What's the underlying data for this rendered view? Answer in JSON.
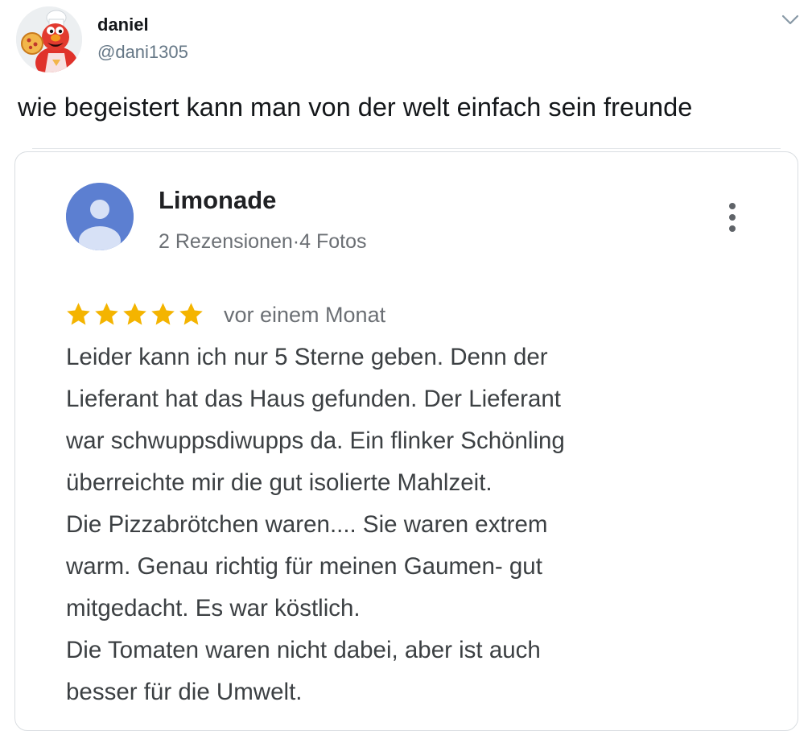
{
  "tweet": {
    "author_name": "daniel",
    "author_handle": "@dani1305",
    "text": "wie begeistert kann man von der welt einfach sein freunde",
    "menu_icon": "chevron-down-icon"
  },
  "review": {
    "reviewer_name": "Limonade",
    "reviewer_meta": "2 Rezensionen·4 Fotos",
    "rating": 5,
    "rating_max": 5,
    "date": "vor einem Monat",
    "body_lines": [
      "Leider kann ich nur 5 Sterne geben. Denn der",
      "Lieferant hat das Haus gefunden. Der Lieferant",
      "war schwuppsdiwupps da. Ein flinker Schönling",
      "überreichte mir die gut isolierte Mahlzeit.",
      "Die Pizzabrötchen waren.... Sie waren extrem",
      "warm. Genau richtig für meinen Gaumen- gut",
      "mitgedacht. Es war köstlich.",
      "Die Tomaten waren nicht dabei, aber ist auch",
      "besser für die Umwelt."
    ],
    "more_icon": "more-vertical-icon",
    "avatar_icon": "person-icon"
  },
  "colors": {
    "star": "#f4b400",
    "reviewer_avatar": "#5c7fd1",
    "handle_gray": "#657786"
  }
}
